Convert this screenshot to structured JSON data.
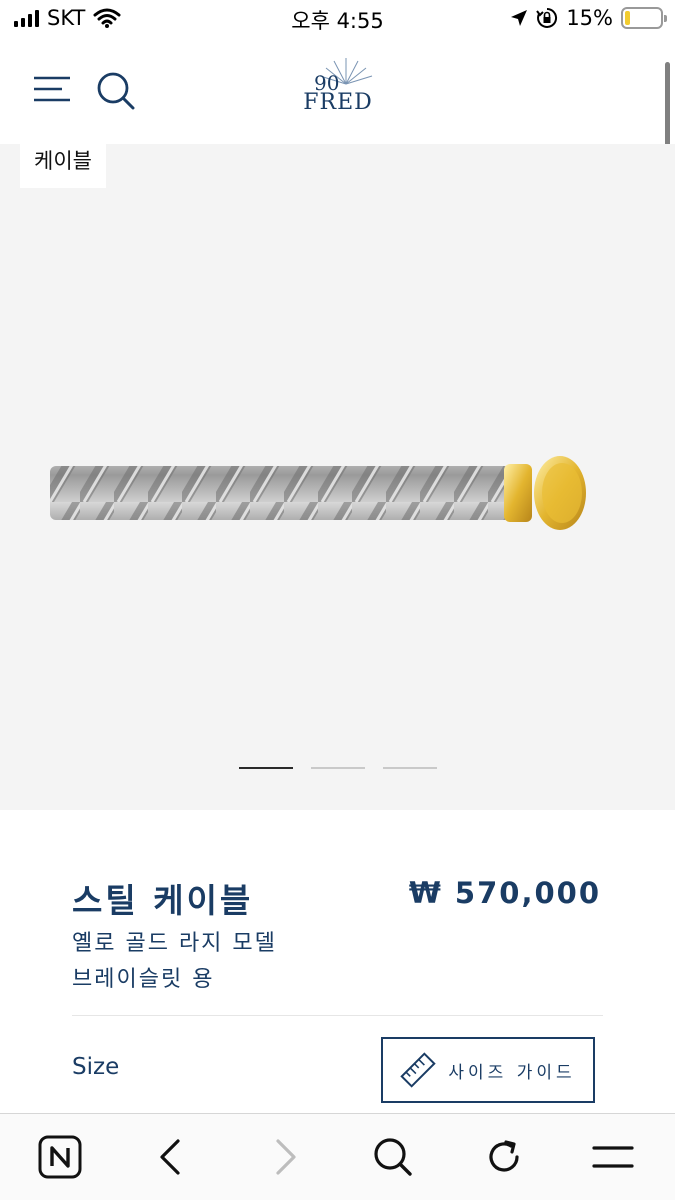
{
  "status_bar": {
    "carrier": "SKT",
    "time": "오후 4:55",
    "battery_percent": "15%",
    "battery_level": 0.15,
    "icons": [
      "signal-icon",
      "wifi-icon",
      "location-icon",
      "rotation-lock-icon",
      "battery-icon"
    ]
  },
  "header": {
    "logo_text": "FRED",
    "logo_mark": "90",
    "icons": [
      "menu-icon",
      "search-icon"
    ]
  },
  "gallery": {
    "category_tag": "케이블",
    "image_alt": "steel-cable-with-yellow-gold-end-cap",
    "slides_total": 3,
    "active_slide": 1
  },
  "product": {
    "title": "스틸 케이블",
    "price": "₩ 570,000",
    "subtitle": "옐로 골드 라지 모델 브레이슬릿 용",
    "size_label": "Size",
    "size_guide_label": "사이즈 가이드"
  },
  "toolbar": {
    "icons": [
      "naver-n-icon",
      "back-icon",
      "forward-icon",
      "search-icon",
      "reload-icon",
      "menu-icon"
    ]
  },
  "colors": {
    "brand_navy": "#1a3c64",
    "gallery_bg": "#f4f4f4",
    "gold": "#e3b52f"
  }
}
